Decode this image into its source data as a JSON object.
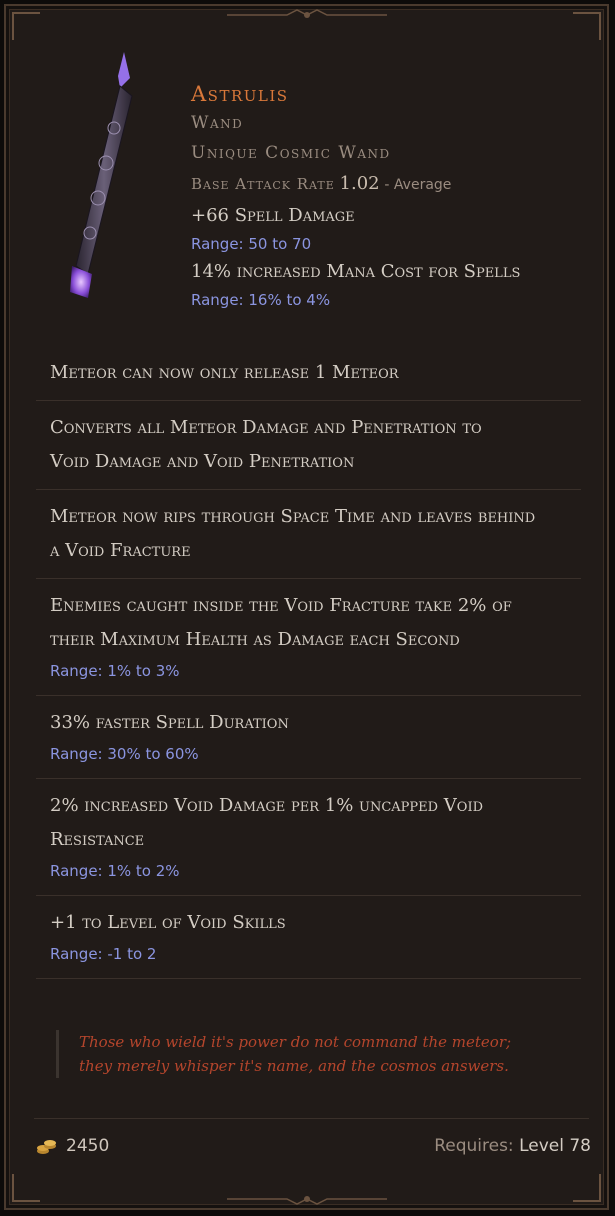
{
  "item": {
    "name": "Astrulis",
    "type": "Wand",
    "rarity_line": "Unique Cosmic Wand",
    "attack_rate_label": "Base Attack Rate",
    "attack_rate_value": "1.02",
    "attack_rate_desc": "- Average"
  },
  "implicits": [
    {
      "text": "+66 Spell Damage",
      "range": "Range: 50 to 70"
    },
    {
      "text": "14% increased Mana Cost for Spells",
      "range": "Range: 16% to 4%"
    }
  ],
  "affixes": [
    {
      "lines": [
        "Meteor can now only release 1 Meteor"
      ],
      "range": ""
    },
    {
      "lines": [
        "Converts all Meteor Damage and Penetration to",
        "Void Damage and Void Penetration"
      ],
      "range": ""
    },
    {
      "lines": [
        "Meteor now rips through Space Time and leaves behind",
        "a Void Fracture"
      ],
      "range": ""
    },
    {
      "lines": [
        "Enemies caught inside the Void Fracture take 2% of",
        "their Maximum Health as Damage each Second"
      ],
      "range": "Range: 1% to 3%"
    },
    {
      "lines": [
        "33% faster Spell Duration"
      ],
      "range": "Range: 30% to 60%"
    },
    {
      "lines": [
        "2% increased Void Damage per 1% uncapped Void",
        "Resistance"
      ],
      "range": "Range: 1% to 2%"
    },
    {
      "lines": [
        "+1 to Level of Void Skills"
      ],
      "range": "Range: -1 to 2"
    }
  ],
  "lore": {
    "line1": "Those who wield it's power do not command the meteor;",
    "line2": "they merely whisper it's name, and the cosmos answers."
  },
  "footer": {
    "gold_value": "2450",
    "requires_label": "Requires:",
    "requires_level": "Level 78"
  },
  "icons": {
    "gold": "gold-coins-icon",
    "wand": "cosmic-wand-icon"
  },
  "colors": {
    "unique_name": "#d9783a",
    "range_text": "#8b95e0",
    "lore_text": "#b4452c",
    "panel_bg": "#211b18"
  }
}
